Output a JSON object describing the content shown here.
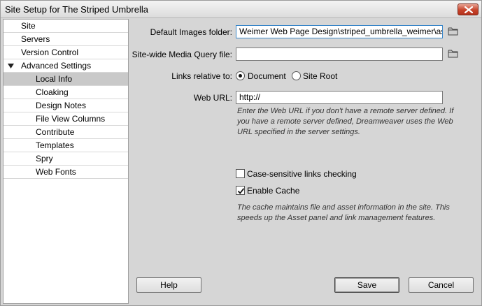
{
  "window": {
    "title": "Site Setup for The Striped Umbrella",
    "close_icon": "close-icon"
  },
  "sidebar": {
    "items": [
      {
        "label": "Site",
        "level": 0
      },
      {
        "label": "Servers",
        "level": 0
      },
      {
        "label": "Version Control",
        "level": 0
      },
      {
        "label": "Advanced Settings",
        "level": 0,
        "expanded": true
      },
      {
        "label": "Local Info",
        "level": 1,
        "selected": true
      },
      {
        "label": "Cloaking",
        "level": 1
      },
      {
        "label": "Design Notes",
        "level": 1
      },
      {
        "label": "File View Columns",
        "level": 1
      },
      {
        "label": "Contribute",
        "level": 1
      },
      {
        "label": "Templates",
        "level": 1
      },
      {
        "label": "Spry",
        "level": 1
      },
      {
        "label": "Web Fonts",
        "level": 1
      }
    ]
  },
  "form": {
    "default_images": {
      "label": "Default Images folder:",
      "value": "Weimer Web Page Design\\striped_umbrella_weimer\\assets\\"
    },
    "media_query": {
      "label": "Site-wide Media Query file:",
      "value": ""
    },
    "links_relative": {
      "label": "Links relative to:",
      "options": [
        "Document",
        "Site Root"
      ],
      "selected": "Document"
    },
    "web_url": {
      "label": "Web URL:",
      "value": "http://",
      "note": "Enter the Web URL if you don't have a remote server defined. If you have a remote server defined, Dreamweaver uses the Web URL specified in the server settings."
    },
    "case_sensitive": {
      "label": "Case-sensitive links checking",
      "checked": false
    },
    "enable_cache": {
      "label": "Enable Cache",
      "checked": true,
      "note": "The cache maintains file and asset information in the site. This speeds up the Asset panel and link management features."
    }
  },
  "buttons": {
    "help": "Help",
    "save": "Save",
    "cancel": "Cancel"
  },
  "colors": {
    "dialog_bg": "#d6d6d6",
    "selected_item": "#c9c9c9",
    "close_button": "#c7432b",
    "focus_border": "#3a86c8"
  }
}
